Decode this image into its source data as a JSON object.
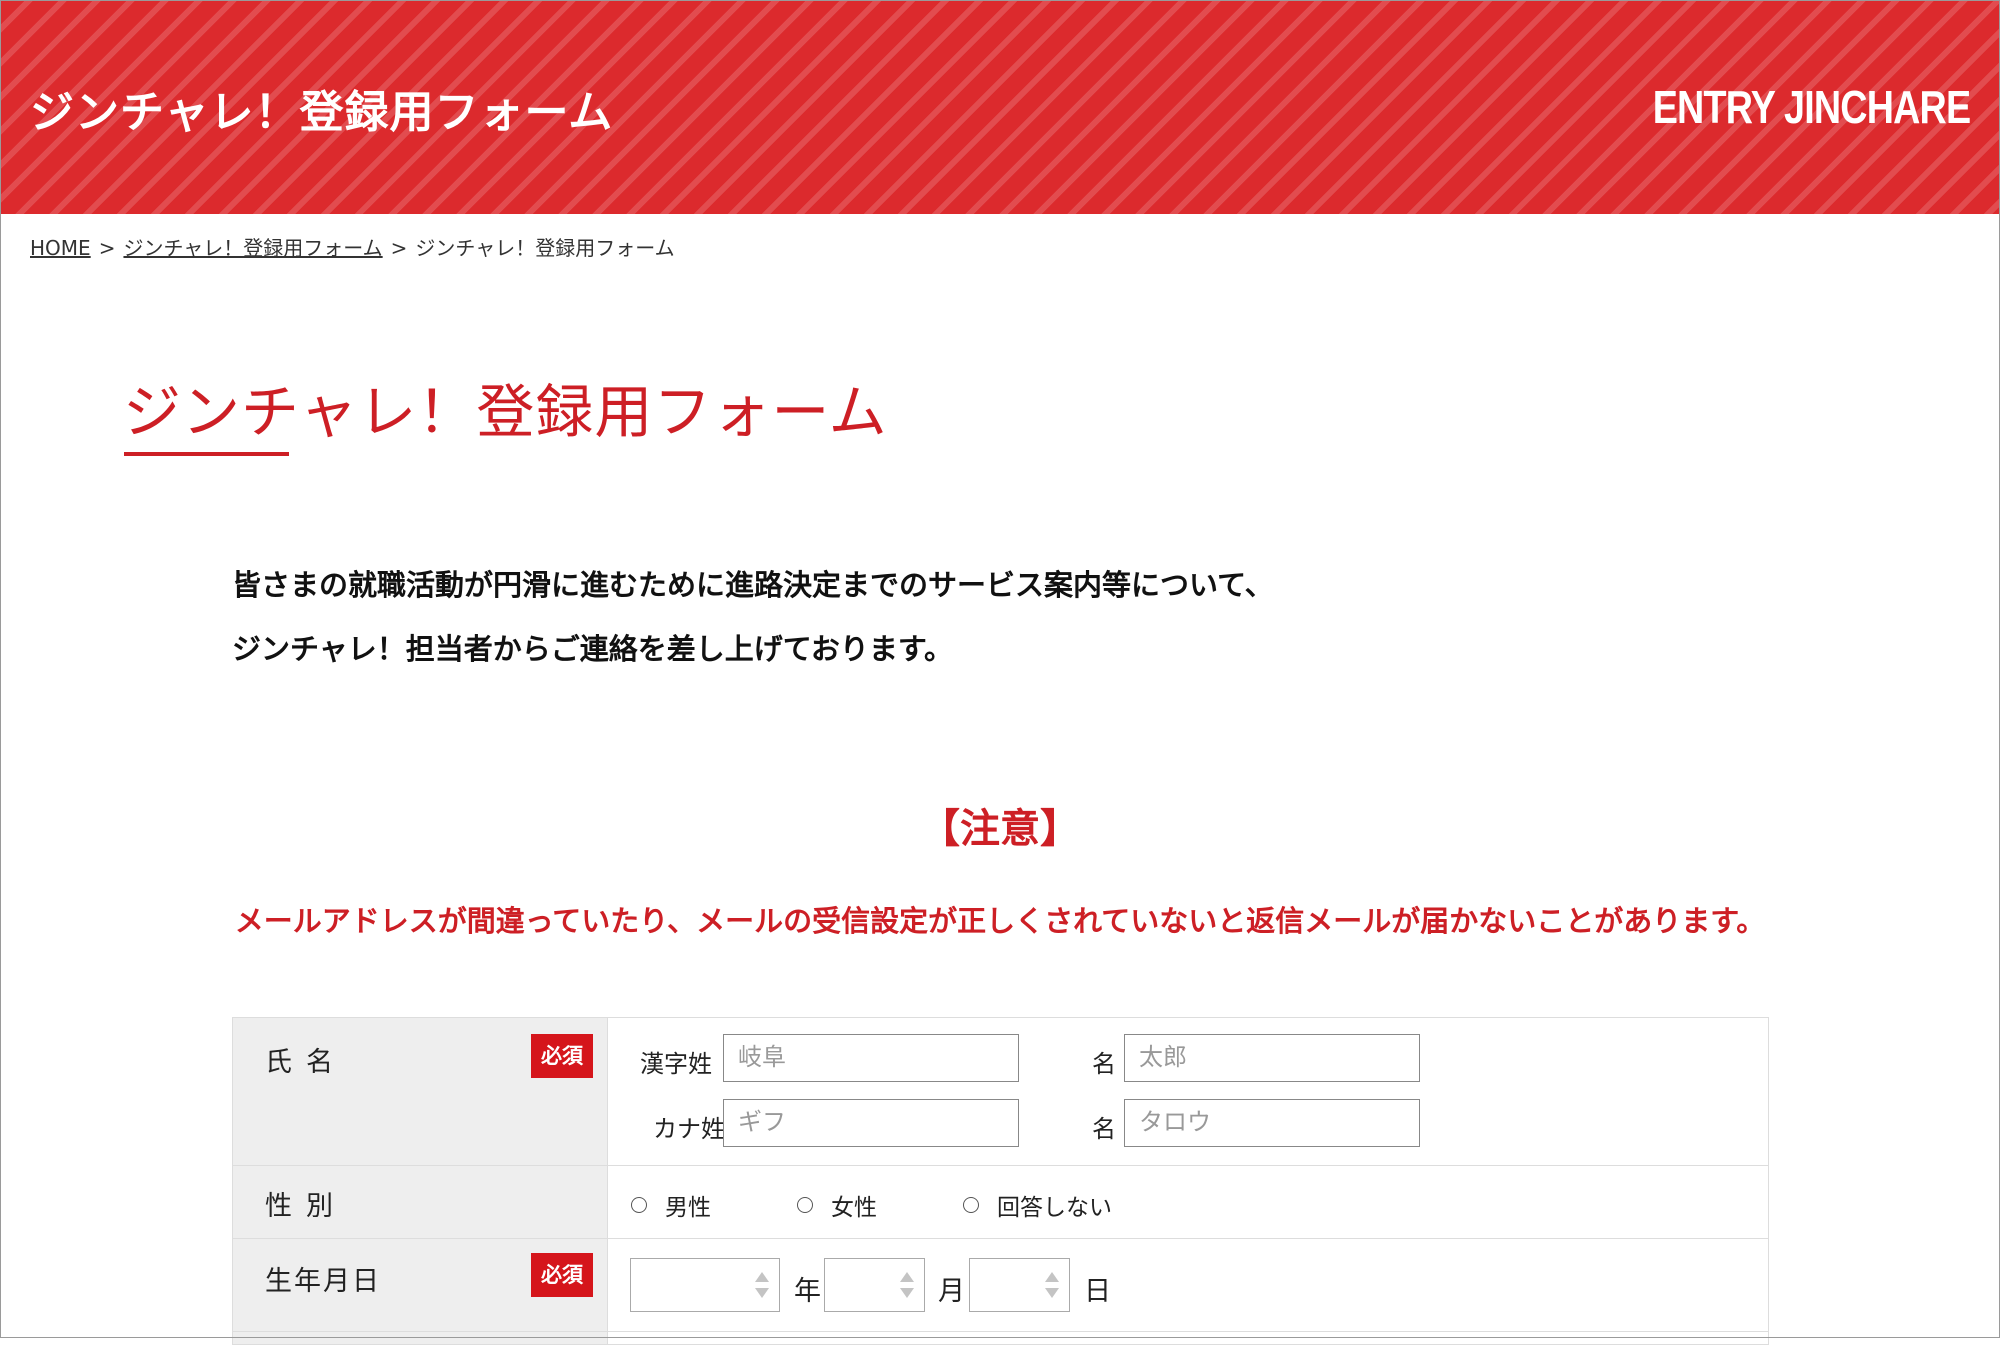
{
  "header": {
    "title": "ジンチャレ！登録用フォーム",
    "title_en": "ENTRY JINCHARE",
    "brand_color": "#dc2a2d"
  },
  "breadcrumb": {
    "items": [
      "HOME",
      "ジンチャレ！登録用フォーム",
      "ジンチャレ！登録用フォーム"
    ],
    "separator": ">"
  },
  "page": {
    "title": "ジンチャレ！登録用フォーム",
    "intro_line1": "皆さまの就職活動が円滑に進むために進路決定までのサービス案内等について、",
    "intro_line2": "ジンチャレ！担当者からご連絡を差し上げております。"
  },
  "notice": {
    "heading": "【注意】",
    "text": "メールアドレスが間違っていたり、メールの受信設定が正しくされていないと返信メールが届かないことがあります。",
    "color": "#cd1f25"
  },
  "form": {
    "required_label": "必須",
    "name": {
      "label": "氏名",
      "kanji_last_label": "漢字姓",
      "kanji_last_placeholder": "岐阜",
      "kanji_first_label": "名",
      "kanji_first_placeholder": "太郎",
      "kana_last_label": "カナ姓",
      "kana_last_placeholder": "ギフ",
      "kana_first_label": "名",
      "kana_first_placeholder": "タロウ"
    },
    "gender": {
      "label": "性別",
      "options": [
        "男性",
        "女性",
        "回答しない"
      ]
    },
    "birthdate": {
      "label": "生年月日",
      "year_unit": "年",
      "month_unit": "月",
      "day_unit": "日",
      "year_value": "",
      "month_value": "",
      "day_value": ""
    }
  }
}
